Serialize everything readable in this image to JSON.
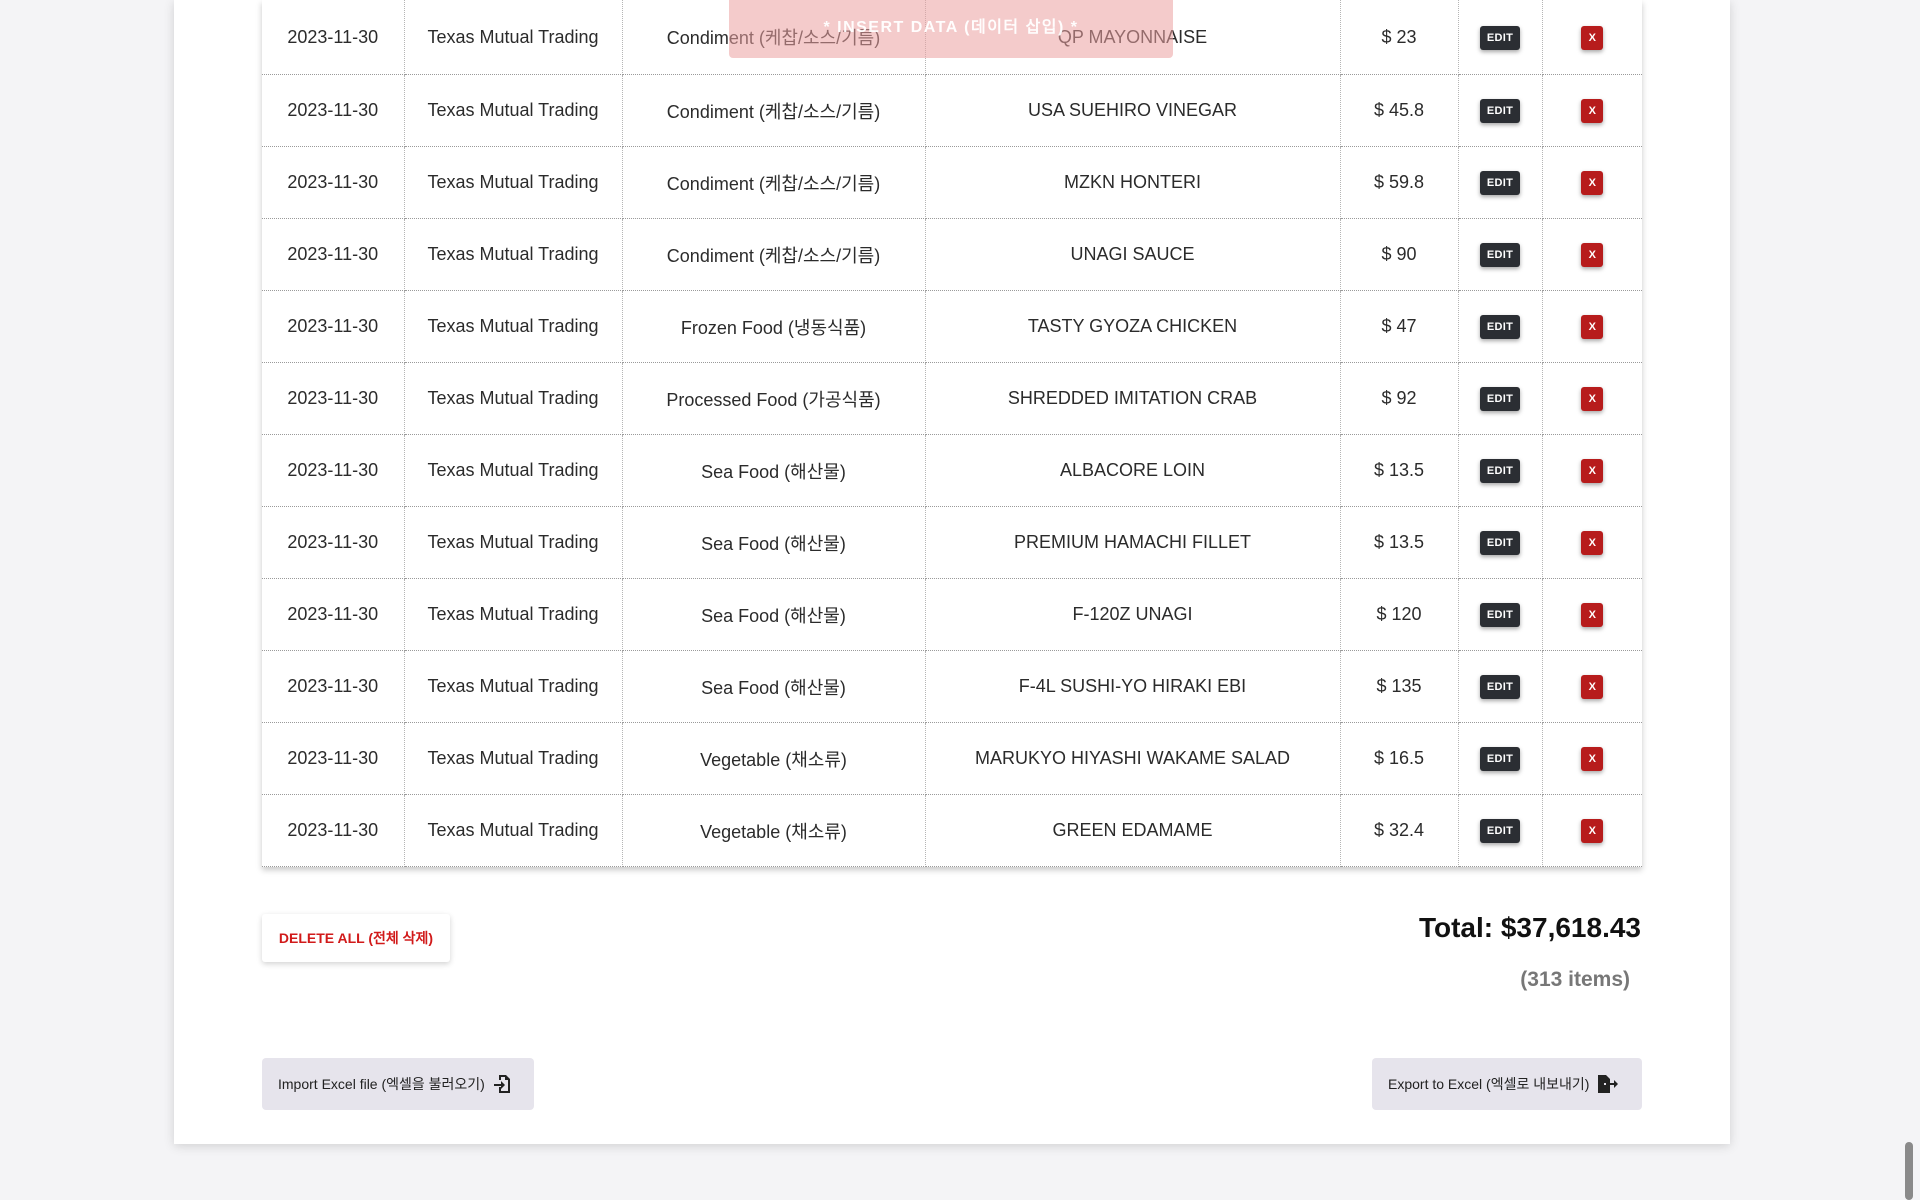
{
  "overlay": {
    "label": "* INSERT DATA (데이터 삽입) *"
  },
  "rows": [
    {
      "date": "2023-11-30",
      "vendor": "Texas Mutual Trading",
      "category": "Condiment (케찹/소스/기름)",
      "item": "QP MAYONNAISE",
      "price": "$ 23",
      "edit": "EDIT",
      "del": "X"
    },
    {
      "date": "2023-11-30",
      "vendor": "Texas Mutual Trading",
      "category": "Condiment (케찹/소스/기름)",
      "item": "USA SUEHIRO VINEGAR",
      "price": "$ 45.8",
      "edit": "EDIT",
      "del": "X"
    },
    {
      "date": "2023-11-30",
      "vendor": "Texas Mutual Trading",
      "category": "Condiment (케찹/소스/기름)",
      "item": "MZKN HONTERI",
      "price": "$ 59.8",
      "edit": "EDIT",
      "del": "X"
    },
    {
      "date": "2023-11-30",
      "vendor": "Texas Mutual Trading",
      "category": "Condiment (케찹/소스/기름)",
      "item": "UNAGI SAUCE",
      "price": "$ 90",
      "edit": "EDIT",
      "del": "X"
    },
    {
      "date": "2023-11-30",
      "vendor": "Texas Mutual Trading",
      "category": "Frozen Food (냉동식품)",
      "item": "TASTY GYOZA CHICKEN",
      "price": "$ 47",
      "edit": "EDIT",
      "del": "X"
    },
    {
      "date": "2023-11-30",
      "vendor": "Texas Mutual Trading",
      "category": "Processed Food (가공식품)",
      "item": "SHREDDED IMITATION CRAB",
      "price": "$ 92",
      "edit": "EDIT",
      "del": "X"
    },
    {
      "date": "2023-11-30",
      "vendor": "Texas Mutual Trading",
      "category": "Sea Food (해산물)",
      "item": "ALBACORE LOIN",
      "price": "$ 13.5",
      "edit": "EDIT",
      "del": "X"
    },
    {
      "date": "2023-11-30",
      "vendor": "Texas Mutual Trading",
      "category": "Sea Food (해산물)",
      "item": "PREMIUM HAMACHI FILLET",
      "price": "$ 13.5",
      "edit": "EDIT",
      "del": "X"
    },
    {
      "date": "2023-11-30",
      "vendor": "Texas Mutual Trading",
      "category": "Sea Food (해산물)",
      "item": "F-120Z UNAGI",
      "price": "$ 120",
      "edit": "EDIT",
      "del": "X"
    },
    {
      "date": "2023-11-30",
      "vendor": "Texas Mutual Trading",
      "category": "Sea Food (해산물)",
      "item": "F-4L SUSHI-YO HIRAKI EBI",
      "price": "$ 135",
      "edit": "EDIT",
      "del": "X"
    },
    {
      "date": "2023-11-30",
      "vendor": "Texas Mutual Trading",
      "category": "Vegetable (채소류)",
      "item": "MARUKYO HIYASHI WAKAME SALAD",
      "price": "$ 16.5",
      "edit": "EDIT",
      "del": "X"
    },
    {
      "date": "2023-11-30",
      "vendor": "Texas Mutual Trading",
      "category": "Vegetable (채소류)",
      "item": "GREEN EDAMAME",
      "price": "$ 32.4",
      "edit": "EDIT",
      "del": "X"
    }
  ],
  "footer": {
    "delete_all": "DELETE ALL (전체 삭제)",
    "total": "Total: $37,618.43",
    "items_count": "(313 items)",
    "import_label": "Import Excel file (엑셀을 불러오기)",
    "export_label": "Export to Excel (엑셀로 내보내기)"
  },
  "icons": {
    "import": "file-import-icon",
    "export": "file-export-icon"
  },
  "colors": {
    "edit_button": "#2b2e33",
    "delete_button": "#b71c1c",
    "delete_all_text": "#d11a1a",
    "excel_button_bg": "#e6e4ec"
  }
}
